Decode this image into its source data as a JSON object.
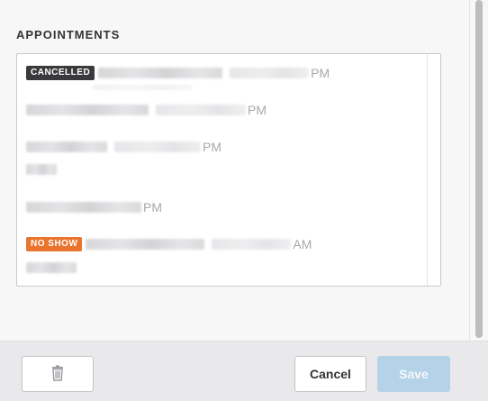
{
  "section": {
    "title": "APPOINTMENTS"
  },
  "appointments": [
    {
      "badge": "CANCELLED",
      "time_suffix": "PM"
    },
    {
      "badge": "",
      "time_suffix": "PM"
    },
    {
      "badge": "",
      "time_suffix": "PM"
    },
    {
      "badge": "",
      "time_suffix": "PM"
    },
    {
      "badge": "NO SHOW",
      "time_suffix": "AM"
    }
  ],
  "footer": {
    "delete_icon": "trash-icon",
    "cancel_label": "Cancel",
    "save_label": "Save"
  },
  "colors": {
    "cancelled_badge": "#3a3a3d",
    "noshow_badge": "#e8742e",
    "save_disabled": "#b4d3e9"
  }
}
